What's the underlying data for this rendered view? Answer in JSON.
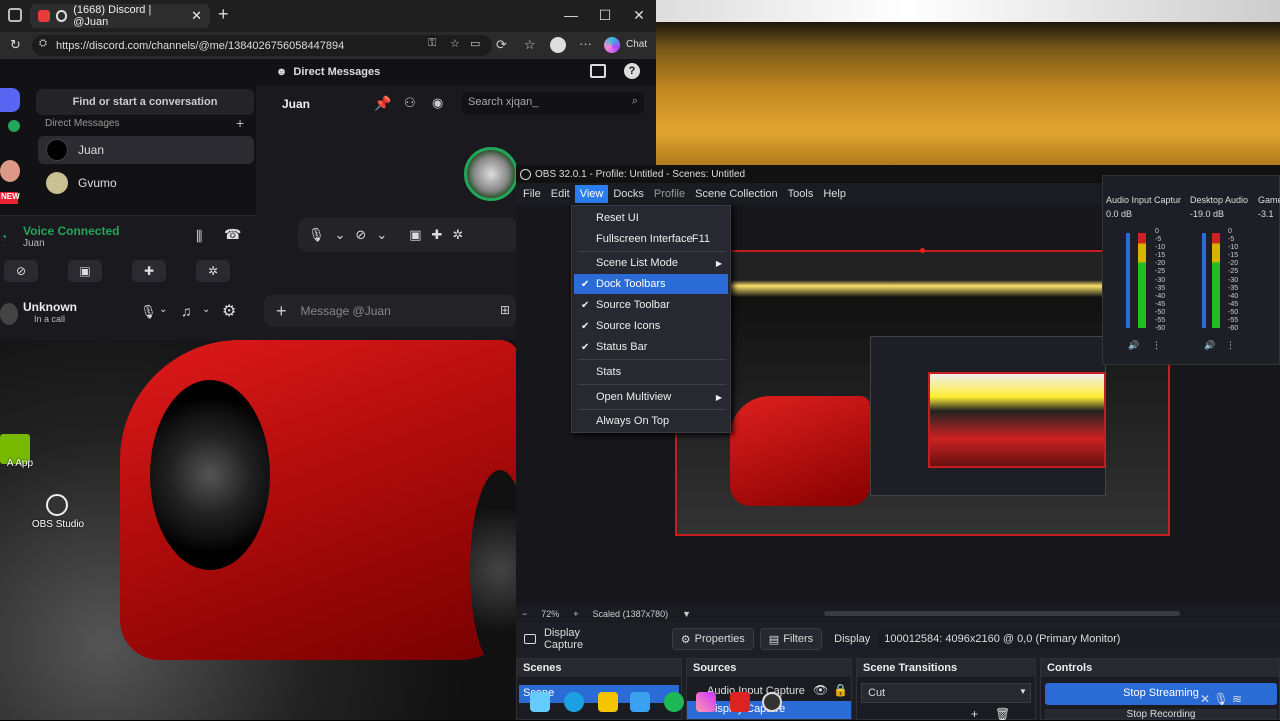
{
  "browser": {
    "tab_title": "(1668) Discord | @Juan",
    "new_tab": "+",
    "url": "https://discord.com/channels/@me/1384026756058447894",
    "chat_label": "Chat"
  },
  "discord": {
    "header": "Direct Messages",
    "search_dm": "Find or start a conversation",
    "dm_section": "Direct Messages",
    "dm_add": "+",
    "dms": [
      "Juan",
      "Gvumo"
    ],
    "new_badge": "NEW",
    "voice_status": "Voice Connected",
    "voice_channel": "Juan",
    "user_name": "Unknown",
    "user_status": "In a call",
    "chat_name": "Juan",
    "search_placeholder": "Search xjqan_",
    "message_placeholder": "Message @Juan"
  },
  "desktop": {
    "icons": [
      "A App",
      "OBS Studio"
    ]
  },
  "obs": {
    "title": "OBS 32.0.1 - Profile: Untitled - Scenes: Untitled",
    "menu": [
      "File",
      "Edit",
      "View",
      "Docks",
      "Profile",
      "Scene Collection",
      "Tools",
      "Help"
    ],
    "view_menu": [
      {
        "label": "Reset UI",
        "checked": false,
        "shortcut": "",
        "submenu": false
      },
      {
        "label": "Fullscreen Interface",
        "checked": false,
        "shortcut": "F11",
        "submenu": false
      },
      {
        "label": "Scene List Mode",
        "checked": false,
        "shortcut": "",
        "submenu": true
      },
      {
        "label": "Dock Toolbars",
        "checked": true,
        "shortcut": "",
        "submenu": false
      },
      {
        "label": "Source Toolbar",
        "checked": true,
        "shortcut": "",
        "submenu": false
      },
      {
        "label": "Source Icons",
        "checked": true,
        "shortcut": "",
        "submenu": false
      },
      {
        "label": "Status Bar",
        "checked": true,
        "shortcut": "",
        "submenu": false
      },
      {
        "label": "Stats",
        "checked": false,
        "shortcut": "",
        "submenu": false
      },
      {
        "label": "Open Multiview",
        "checked": false,
        "shortcut": "",
        "submenu": true
      },
      {
        "label": "Always On Top",
        "checked": false,
        "shortcut": "",
        "submenu": false
      }
    ],
    "zoom": "72%",
    "scaled": "Scaled (1387x780)",
    "source_name": "Display Capture",
    "properties": "Properties",
    "filters": "Filters",
    "display_label": "Display",
    "display_value": "100012584: 4096x2160 @ 0,0 (Primary Monitor)",
    "mixer": [
      {
        "name": "Audio Input Captur",
        "db": "0.0 dB"
      },
      {
        "name": "Desktop Audio",
        "db": "-19.0 dB"
      },
      {
        "name": "Game",
        "db": "-3.1"
      }
    ],
    "meter_ticks": [
      "0",
      "-5",
      "-10",
      "-15",
      "-20",
      "-25",
      "-30",
      "-35",
      "-40",
      "-45",
      "-50",
      "-55",
      "-60"
    ],
    "docks": {
      "scenes": "Scenes",
      "scene_item": "Scene",
      "sources": "Sources",
      "source_items": [
        "Audio Input Capture",
        "Display Capture"
      ],
      "transitions": "Scene Transitions",
      "transition_value": "Cut",
      "controls": "Controls",
      "stop_streaming": "Stop Streaming",
      "stop_recording": "Stop Recording"
    }
  }
}
